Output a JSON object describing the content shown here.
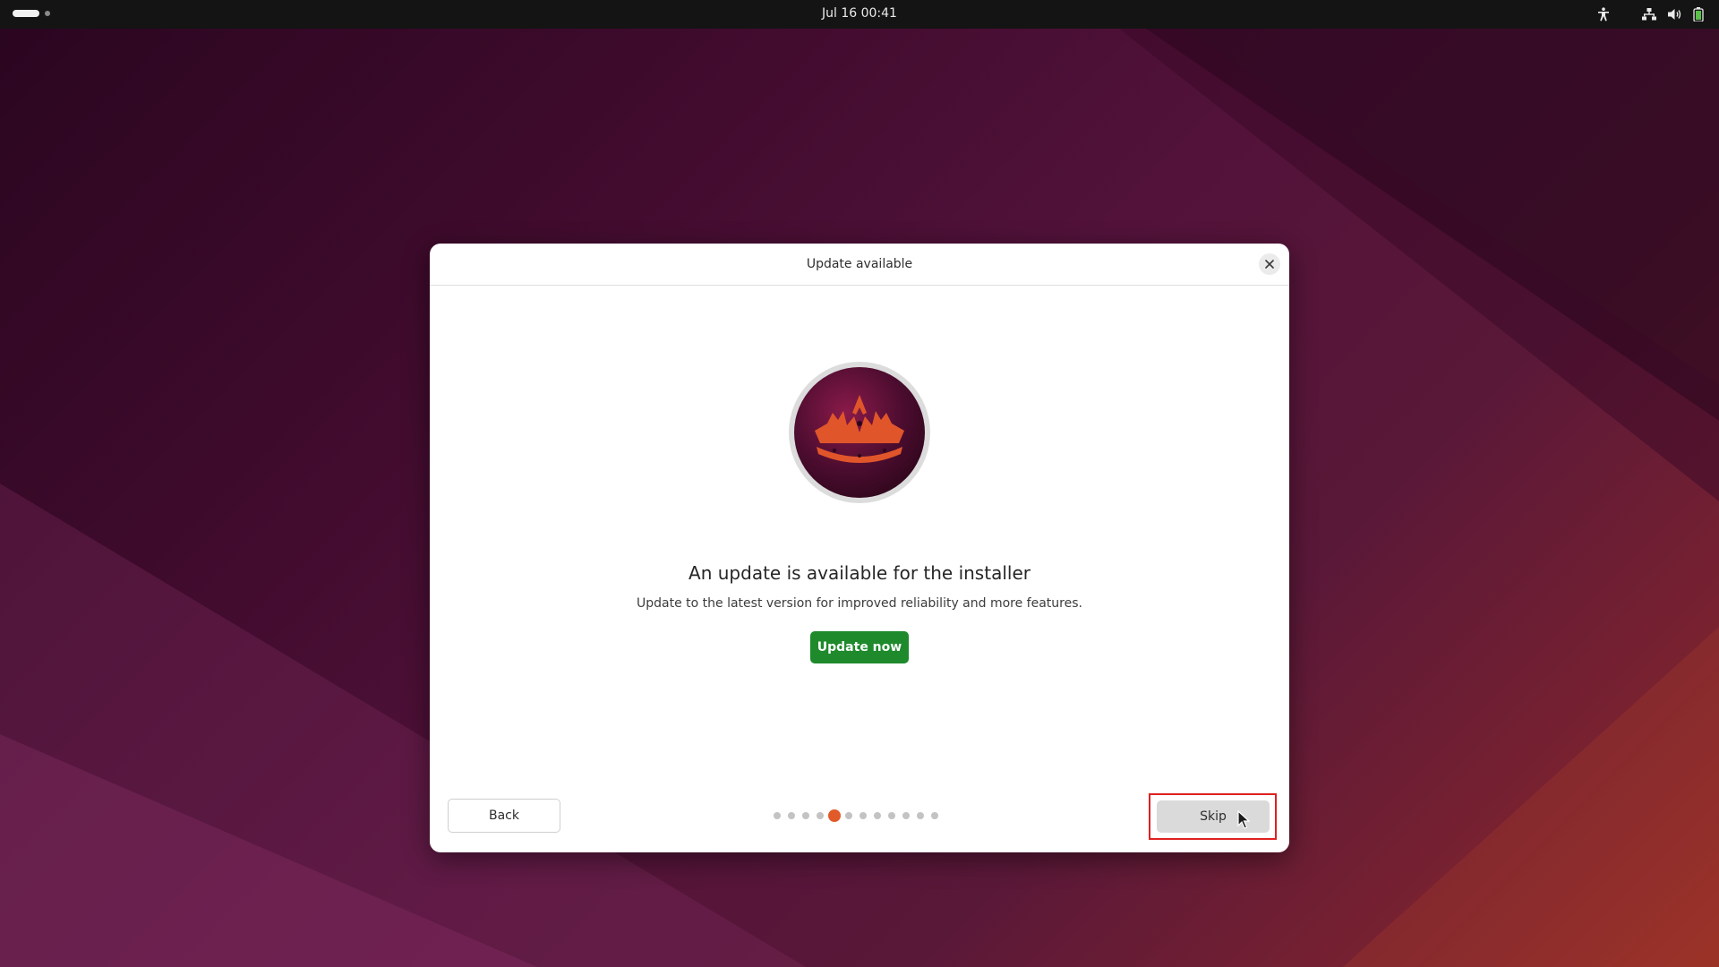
{
  "topbar": {
    "datetime": "Jul 16  00:41",
    "tray_icons": [
      "accessibility-icon",
      "network-icon",
      "volume-icon",
      "battery-icon"
    ]
  },
  "dialog": {
    "title": "Update available",
    "headline": "An update is available for the installer",
    "description": "Update to the latest version for improved reliability and more features.",
    "update_button": "Update now",
    "back_button": "Back",
    "skip_button": "Skip",
    "progress": {
      "total_steps": 12,
      "current_step": 5
    }
  },
  "colors": {
    "accent": "#e05a2a",
    "update_button": "#1e8a2c",
    "highlight": "#e02020",
    "topbar": "#141414"
  }
}
